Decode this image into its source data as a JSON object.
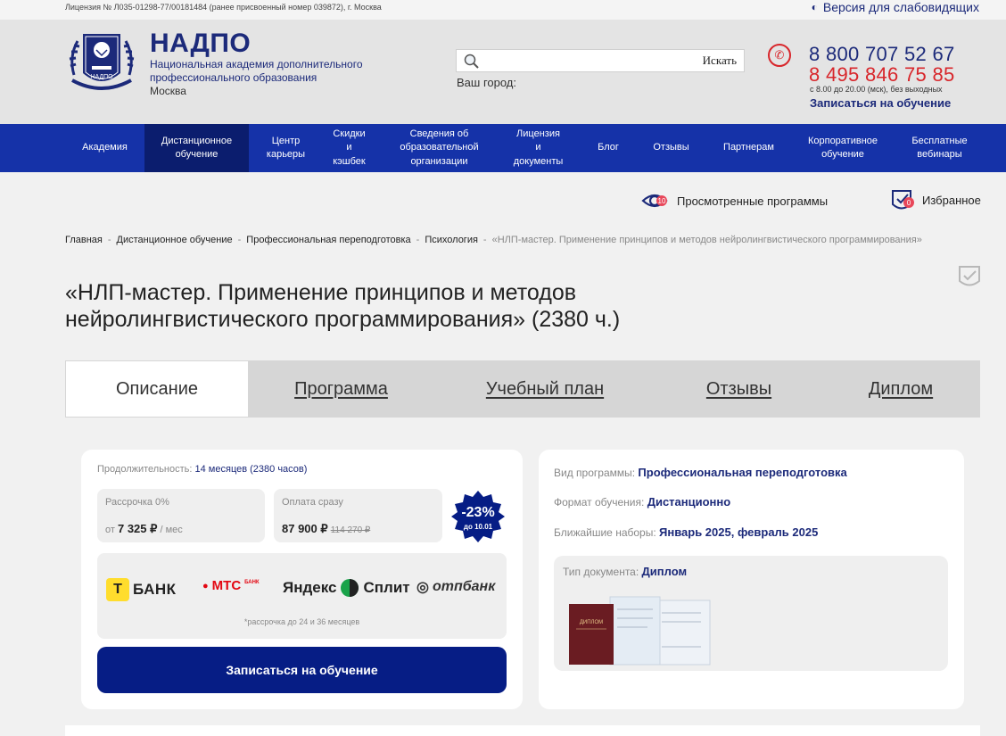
{
  "topbar": {
    "license": "Лицензия № Л035-01298-77/00181484 (ранее присвоенный номер 039872), г. Москва",
    "accessibility": "Версия для слабовидящих"
  },
  "header": {
    "brand": "НАДПО",
    "brand_desc": "Национальная академия дополнительного профессионального образования",
    "city": "Москва",
    "emblem_text": "НАДПО",
    "search_placeholder": "",
    "search_button": "Искать",
    "city_label": "Ваш город:",
    "phone1": "8 800 707 52 67",
    "phone2": "8 495 846 75 85",
    "hours": "с 8.00 до 20.00 (мск), без выходных",
    "signup": "Записаться на обучение"
  },
  "nav": {
    "items": [
      {
        "label": "Академия",
        "active": false
      },
      {
        "label": "Дистанционное\nобучение",
        "active": true
      },
      {
        "label": "Центр\nкарьеры",
        "active": false
      },
      {
        "label": "Скидки\nи\nкэшбек",
        "active": false
      },
      {
        "label": "Сведения об\nобразовательной\nорганизации",
        "active": false
      },
      {
        "label": "Лицензия\nи\nдокументы",
        "active": false
      },
      {
        "label": "Блог",
        "active": false
      },
      {
        "label": "Отзывы",
        "active": false
      },
      {
        "label": "Партнерам",
        "active": false
      },
      {
        "label": "Корпоративное\nобучение",
        "active": false
      },
      {
        "label": "Бесплатные\nвебинары",
        "active": false
      }
    ]
  },
  "favbar": {
    "viewed_label": "Просмотренные программы",
    "viewed_count": "10",
    "fav_label": "Избранное",
    "fav_count": "0"
  },
  "breadcrumb": {
    "items": [
      "Главная",
      "Дистанционное обучение",
      "Профессиональная переподготовка",
      "Психология"
    ],
    "current": "«НЛП-мастер. Применение принципов и методов нейролингвистического программирования»"
  },
  "title": "«НЛП-мастер. Применение принципов и методов нейролингвистического программирования» (2380 ч.)",
  "tabs": [
    "Описание",
    "Программа",
    "Учебный план",
    "Отзывы",
    "Диплом"
  ],
  "price": {
    "duration_label": "Продолжительность:",
    "duration_value": "14 месяцев (2380 часов)",
    "installment_label": "Рассрочка 0%",
    "installment_prefix": "от",
    "installment_value": "7 325 ₽",
    "installment_suffix": "/ мес",
    "full_label": "Оплата сразу",
    "full_value": "87 900 ₽",
    "full_old": "114 270 ₽",
    "discount": "-23%",
    "discount_until": "до 10.01",
    "banks": [
      "БАНК",
      "МТС",
      "БАНК",
      "Яндекс",
      "Сплит",
      "отпбанк"
    ],
    "bank_t_letter": "Т",
    "banks_note": "*рассрочка до 24 и 36 месяцев",
    "signup_button": "Записаться на обучение"
  },
  "info": {
    "type_label": "Вид программы:",
    "type_value": "Профессиональная переподготовка",
    "format_label": "Формат обучения:",
    "format_value": "Дистанционно",
    "start_label": "Ближайшие наборы:",
    "start_value": "Январь 2025, февраль 2025",
    "doc_label": "Тип документа:",
    "doc_value": "Диплом",
    "diploma_cover_text": "ДИПЛОМ"
  },
  "colors": {
    "brand_blue": "#1c2a7a",
    "nav_blue": "#1532a8",
    "nav_active": "#0b1d6e",
    "button_blue": "#061d85",
    "accent_red": "#d8262b"
  }
}
